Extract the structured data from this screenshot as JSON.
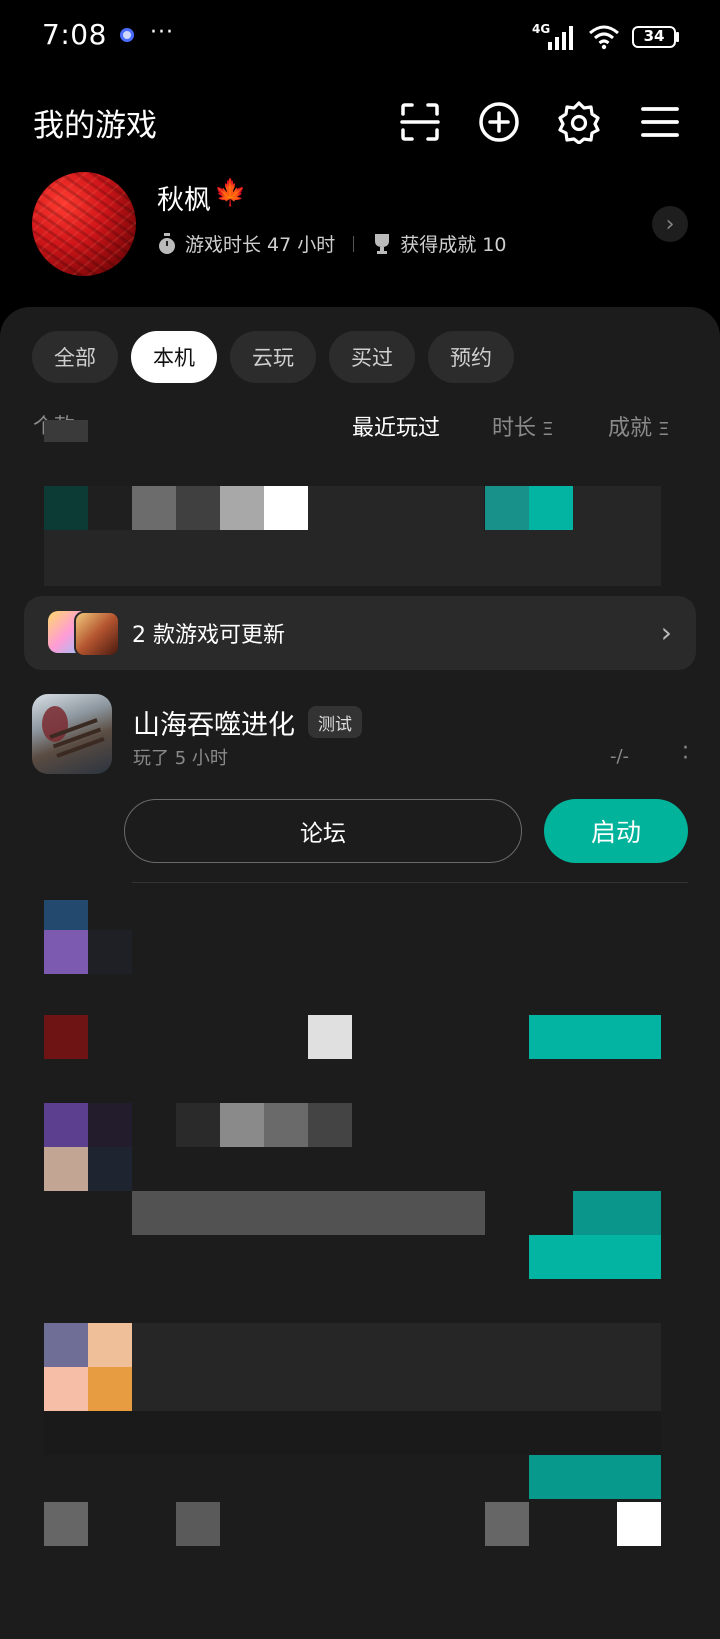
{
  "status_bar": {
    "time": "7:08",
    "more": "···",
    "network": "4G",
    "battery": "34"
  },
  "header": {
    "title": "我的游戏",
    "icons": [
      "scan-icon",
      "add-icon",
      "settings-icon",
      "menu-icon"
    ]
  },
  "profile": {
    "name": "秋枫",
    "name_emoji": "🍁",
    "play_time": "游戏时长 47 小时",
    "achievements": "获得成就 10"
  },
  "tabs": [
    {
      "label": "全部",
      "active": false
    },
    {
      "label": "本机",
      "active": true
    },
    {
      "label": "云玩",
      "active": false
    },
    {
      "label": "买过",
      "active": false
    },
    {
      "label": "预约",
      "active": false
    }
  ],
  "sort": {
    "count_label": "个款",
    "recent": "最近玩过",
    "duration": "时长",
    "achievements": "成就"
  },
  "update_banner": {
    "text": "2 款游戏可更新"
  },
  "game": {
    "title": "山海吞噬进化",
    "badge": "测试",
    "played": "玩了 5 小时",
    "rating": "-/-",
    "forum_label": "论坛",
    "launch_label": "启动"
  },
  "colors": {
    "accent": "#00b39a",
    "background": "#000000",
    "sheet": "#1c1c1c"
  }
}
